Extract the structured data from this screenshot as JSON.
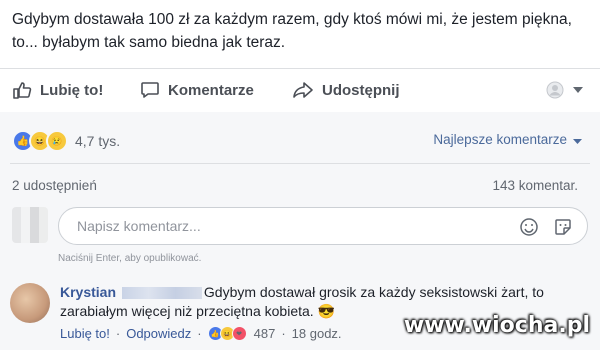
{
  "post": {
    "text": "Gdybym dostawała 100 zł za każdym razem, gdy ktoś mówi mi, że jestem piękna, to... byłabym tak samo biedna jak teraz."
  },
  "actions": {
    "like_label": "Lubię to!",
    "comment_label": "Komentarze",
    "share_label": "Udostępnij"
  },
  "reactions": {
    "count": "4,7 tys.",
    "sort_label": "Najlepsze komentarze"
  },
  "stats": {
    "shares": "2 udostępnień",
    "comments": "143 komentar."
  },
  "composer": {
    "placeholder": "Napisz komentarz...",
    "hint": "Naciśnij Enter, aby opublikować."
  },
  "comment": {
    "author": "Krystian",
    "text": "Gdybym dostawał grosik za każdy seksistowski żart, to zarabiałym więcej niż przeciętna kobieta.",
    "emoji": "😎",
    "like_label": "Lubię to!",
    "reply_label": "Odpowiedz",
    "separator": "·",
    "reaction_count": "487",
    "time": "18 godz."
  },
  "watermark": "www.wiocha.pl",
  "colors": {
    "link": "#385898",
    "reaction_like": "#4a79e9",
    "reaction_yellow": "#f7c93d"
  }
}
